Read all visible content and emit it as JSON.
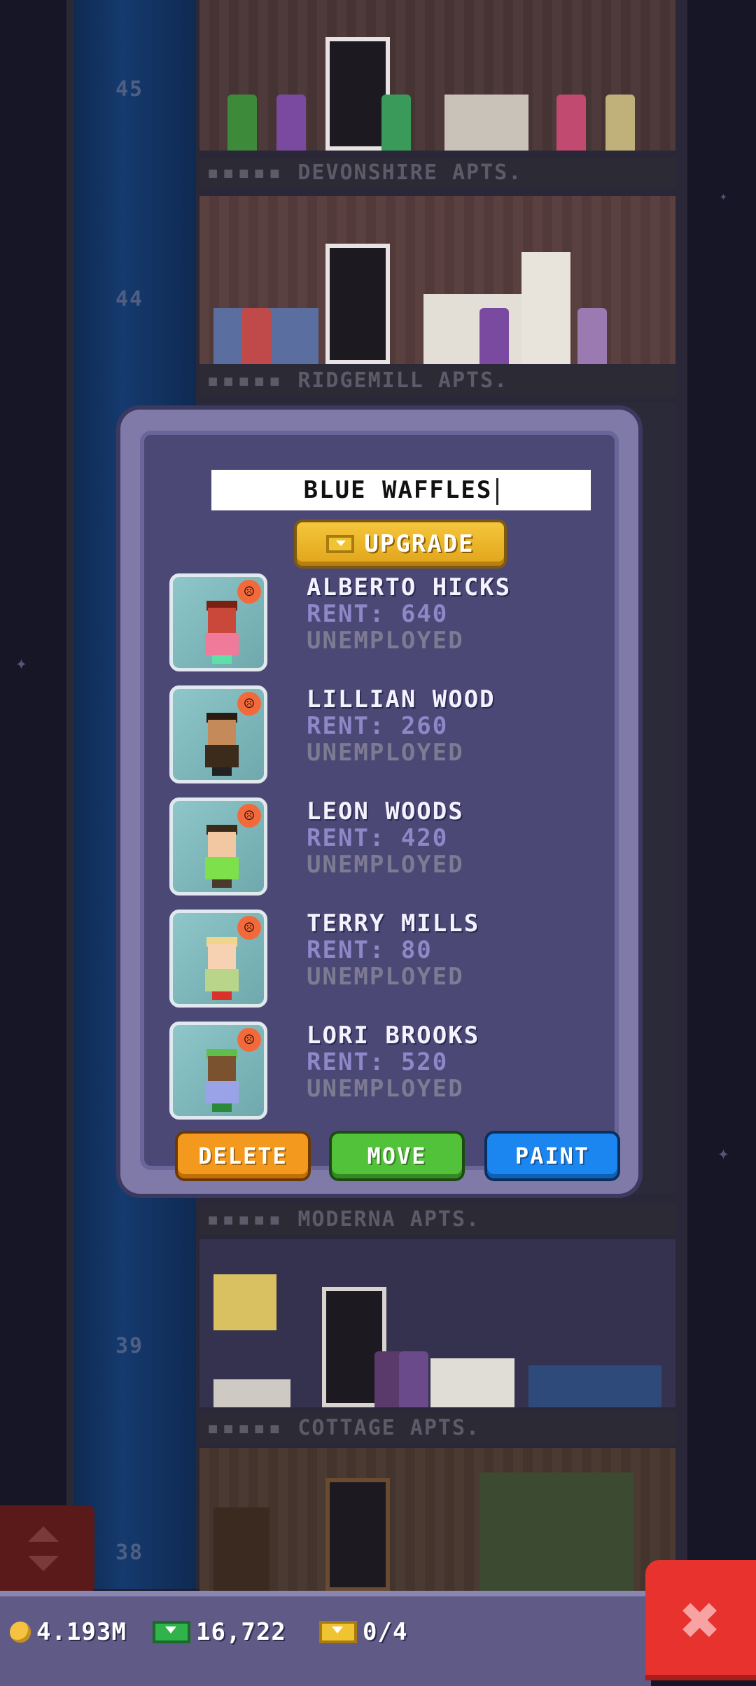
{
  "background": {
    "floor_numbers": [
      "45",
      "44",
      "39",
      "38"
    ],
    "floor_signs": [
      "DEVONSHIRE APTS.",
      "RIDGEMILL APTS.",
      "MODERNA APTS.",
      "COTTAGE APTS."
    ],
    "sign_dots": "▪▪▪▪▪"
  },
  "dialog": {
    "floor_name": "BLUE WAFFLES",
    "upgrade_label": "UPGRADE",
    "residents": [
      {
        "name": "ALBERTO HICKS",
        "rent": "RENT: 640",
        "job": "UNEMPLOYED",
        "mood": "☹",
        "hair": "#7a1f12",
        "skin": "#c9483a",
        "shirt": "#f07a9a",
        "legs": "#5fe0a8"
      },
      {
        "name": "LILLIAN WOOD",
        "rent": "RENT: 260",
        "job": "UNEMPLOYED",
        "mood": "☹",
        "hair": "#2a1a10",
        "skin": "#c48a5a",
        "shirt": "#3c2a1a",
        "legs": "#222222"
      },
      {
        "name": "LEON WOODS",
        "rent": "RENT: 420",
        "job": "UNEMPLOYED",
        "mood": "☹",
        "hair": "#3a2a1a",
        "skin": "#f1c8a2",
        "shirt": "#7ee04a",
        "legs": "#4a3a2a"
      },
      {
        "name": "TERRY MILLS",
        "rent": "RENT: 80",
        "job": "UNEMPLOYED",
        "mood": "☹",
        "hair": "#f0d58a",
        "skin": "#f7d2b2",
        "shirt": "#b9d58a",
        "legs": "#d9322a"
      },
      {
        "name": "LORI BROOKS",
        "rent": "RENT: 520",
        "job": "UNEMPLOYED",
        "mood": "☹",
        "hair": "#5fbf4a",
        "skin": "#7a5230",
        "shirt": "#9aa3e8",
        "legs": "#2a8a3a"
      }
    ],
    "buttons": {
      "delete": "DELETE",
      "move": "MOVE",
      "paint": "PAINT"
    }
  },
  "status_bar": {
    "coins": "4.193M",
    "cash": "16,722",
    "bux": "0/4"
  },
  "close_label": "✖"
}
